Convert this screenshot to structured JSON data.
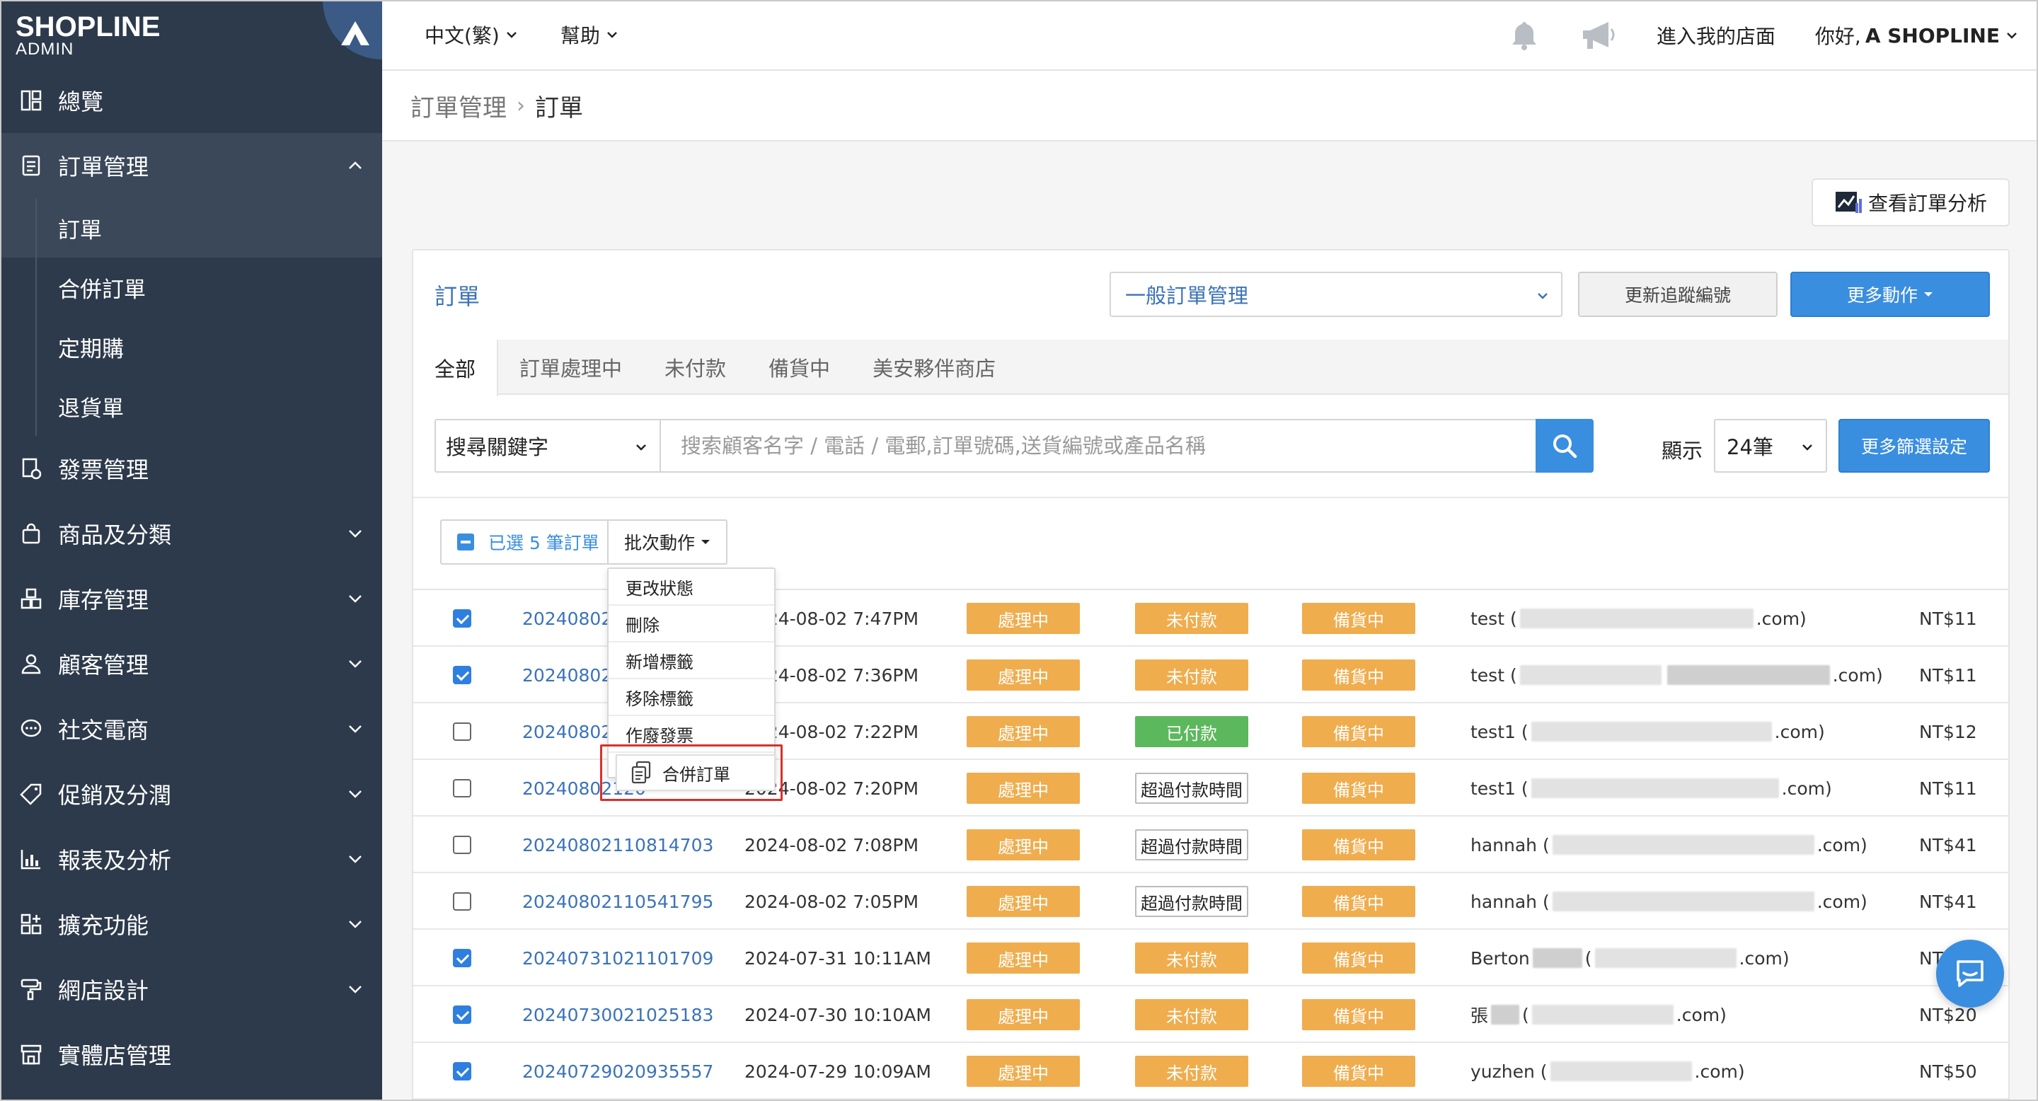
{
  "brand": {
    "name": "SHOPLINE",
    "sub": "ADMIN"
  },
  "sidebar": {
    "items": [
      {
        "label": "總覽",
        "icon": "dashboard-icon"
      },
      {
        "label": "訂單管理",
        "icon": "order-icon",
        "open": true
      },
      {
        "label": "發票管理",
        "icon": "invoice-icon"
      },
      {
        "label": "商品及分類",
        "icon": "bag-icon"
      },
      {
        "label": "庫存管理",
        "icon": "inventory-icon"
      },
      {
        "label": "顧客管理",
        "icon": "user-icon"
      },
      {
        "label": "社交電商",
        "icon": "chat-bubble-icon"
      },
      {
        "label": "促銷及分潤",
        "icon": "tag-icon"
      },
      {
        "label": "報表及分析",
        "icon": "chart-icon"
      },
      {
        "label": "擴充功能",
        "icon": "apps-icon"
      },
      {
        "label": "網店設計",
        "icon": "paint-roller-icon"
      },
      {
        "label": "實體店管理",
        "icon": "store-icon"
      }
    ],
    "sub_items": [
      "訂單",
      "合併訂單",
      "定期購",
      "退貨單"
    ]
  },
  "topbar": {
    "language": "中文(繁)",
    "help": "幫助",
    "store_link": "進入我的店面",
    "greeting_prefix": "你好,",
    "greeting_name": "A SHOPLINE"
  },
  "breadcrumb": {
    "parent": "訂單管理",
    "separator": "›",
    "current": "訂單"
  },
  "analysis_button": "查看訂單分析",
  "panel": {
    "title": "訂單",
    "view_select": "一般訂單管理",
    "track_button": "更新追蹤編號",
    "more_button": "更多動作",
    "tabs": [
      "全部",
      "訂單處理中",
      "未付款",
      "備貨中",
      "美安夥伴商店"
    ],
    "search": {
      "keyword_select": "搜尋關鍵字",
      "placeholder": "搜索顧客名字 / 電話 / 電郵,訂單號碼,送貨編號或產品名稱",
      "show_label": "顯示",
      "show_value": "24筆",
      "filter_button": "更多篩選設定"
    },
    "bulk": {
      "selected_text": "已選 5 筆訂單",
      "action_button": "批次動作"
    }
  },
  "bulk_menu": {
    "items": [
      "更改狀態",
      "刪除",
      "新增標籤",
      "移除標籤",
      "作廢發票"
    ],
    "merge": "合併訂單"
  },
  "orders": [
    {
      "checked": true,
      "no": "20240802144",
      "date": "2024-08-02 7:47PM",
      "status": "處理中",
      "payment": "未付款",
      "pay_type": "unpaid",
      "ship": "備貨中",
      "cust_name": "test (",
      "cust_tail": ".com)",
      "amount": "NT$11"
    },
    {
      "checked": true,
      "no": "20240802133",
      "date": "2024-08-02 7:36PM",
      "status": "處理中",
      "payment": "未付款",
      "pay_type": "unpaid",
      "ship": "備貨中",
      "cust_name": "test (",
      "cust_tail": ".com)",
      "amount": "NT$11"
    },
    {
      "checked": false,
      "no": "20240802122",
      "date": "2024-08-02 7:22PM",
      "status": "處理中",
      "payment": "已付款",
      "pay_type": "paid",
      "ship": "備貨中",
      "cust_name": "test1 (",
      "cust_tail": ".com)",
      "amount": "NT$12"
    },
    {
      "checked": false,
      "no": "20240802120",
      "date": "2024-08-02 7:20PM",
      "status": "處理中",
      "payment": "超過付款時間",
      "pay_type": "expired",
      "ship": "備貨中",
      "cust_name": "test1 (",
      "cust_tail": ".com)",
      "amount": "NT$11"
    },
    {
      "checked": false,
      "no": "20240802110814703",
      "date": "2024-08-02 7:08PM",
      "status": "處理中",
      "payment": "超過付款時間",
      "pay_type": "expired",
      "ship": "備貨中",
      "cust_name": "hannah (",
      "cust_tail": ".com)",
      "amount": "NT$41"
    },
    {
      "checked": false,
      "no": "20240802110541795",
      "date": "2024-08-02 7:05PM",
      "status": "處理中",
      "payment": "超過付款時間",
      "pay_type": "expired",
      "ship": "備貨中",
      "cust_name": "hannah (",
      "cust_tail": ".com)",
      "amount": "NT$41"
    },
    {
      "checked": true,
      "no": "20240731021101709",
      "date": "2024-07-31 10:11AM",
      "status": "處理中",
      "payment": "未付款",
      "pay_type": "unpaid",
      "ship": "備貨中",
      "cust_name": "Berton",
      "cust_tail": ".com)",
      "amount": "NT"
    },
    {
      "checked": true,
      "no": "20240730021025183",
      "date": "2024-07-30 10:10AM",
      "status": "處理中",
      "payment": "未付款",
      "pay_type": "unpaid",
      "ship": "備貨中",
      "cust_name": "張",
      "cust_tail": ".com)",
      "amount": "NT$20"
    },
    {
      "checked": true,
      "no": "20240729020935557",
      "date": "2024-07-29 10:09AM",
      "status": "處理中",
      "payment": "未付款",
      "pay_type": "unpaid",
      "ship": "備貨中",
      "cust_name": "yuzhen (",
      "cust_tail": ".com)",
      "amount": "NT$50"
    }
  ],
  "colors": {
    "sidebar": "#2d3a4b",
    "accent": "#3a8ee0",
    "status_orange": "#efad4e",
    "paid_green": "#5cb85c",
    "highlight_red": "#d9302b"
  }
}
